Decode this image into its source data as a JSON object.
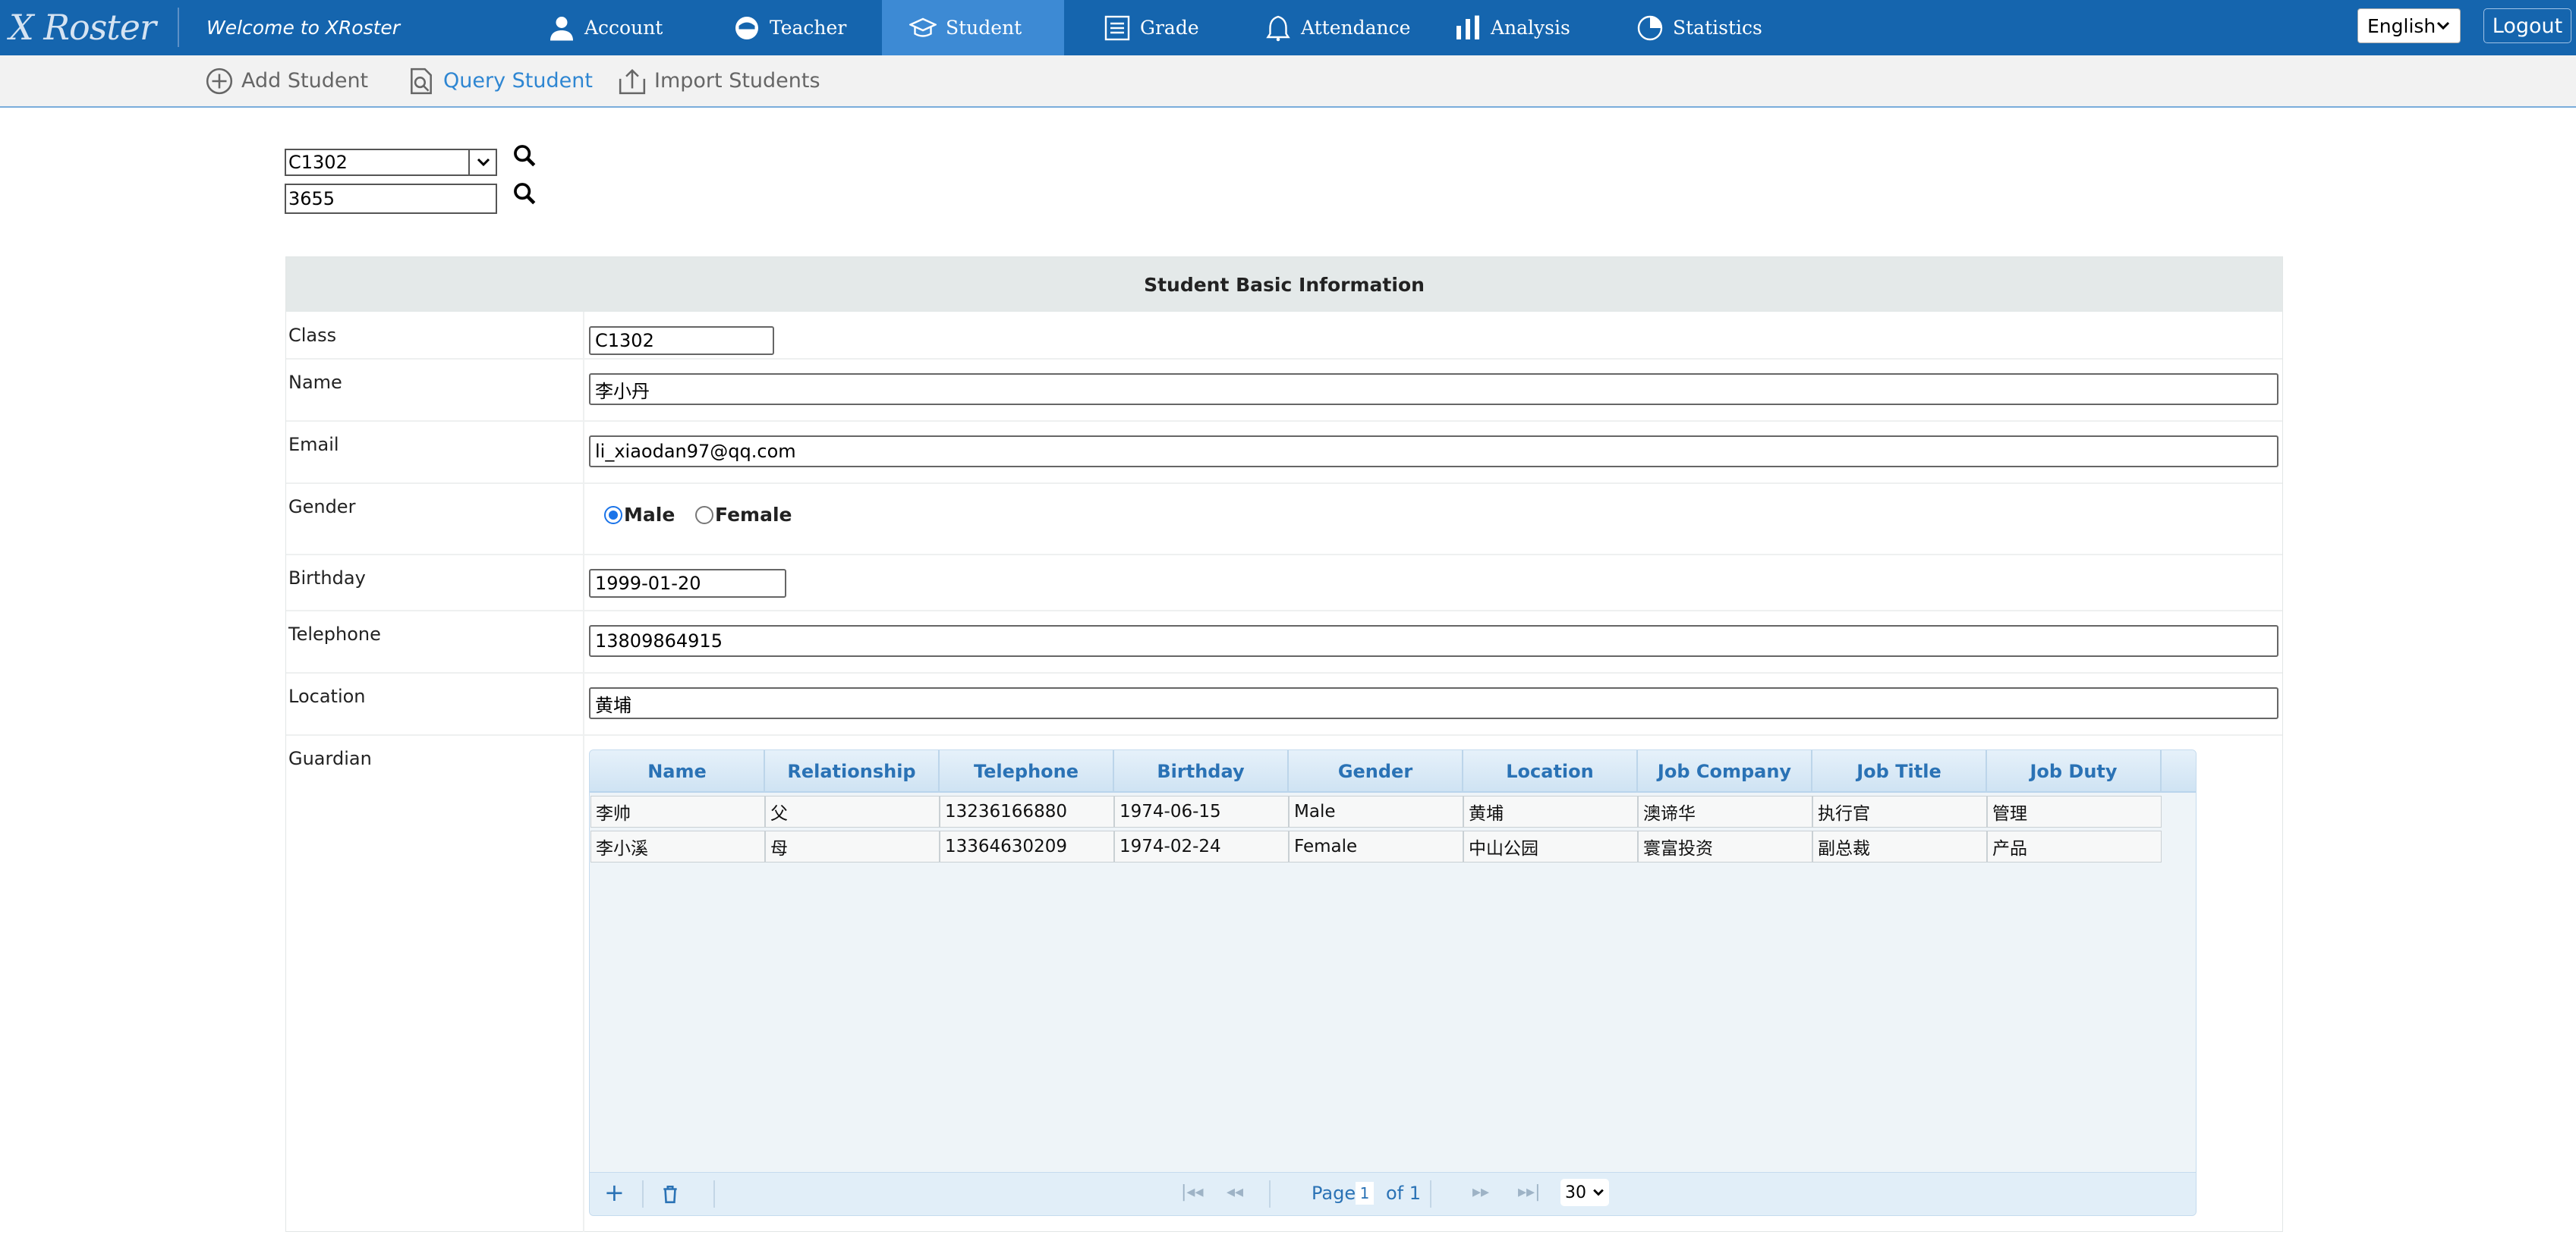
{
  "app": {
    "logo": "X Roster",
    "welcome": "Welcome to XRoster"
  },
  "nav": [
    {
      "label": "Account",
      "icon": "user-icon"
    },
    {
      "label": "Teacher",
      "icon": "teacher-icon"
    },
    {
      "label": "Student",
      "icon": "student-cap-icon",
      "active": true
    },
    {
      "label": "Grade",
      "icon": "grade-list-icon"
    },
    {
      "label": "Attendance",
      "icon": "bell-icon"
    },
    {
      "label": "Analysis",
      "icon": "bar-chart-icon"
    },
    {
      "label": "Statistics",
      "icon": "pie-chart-icon"
    }
  ],
  "header": {
    "language": "English",
    "logout": "Logout"
  },
  "subnav": [
    {
      "label": "Add Student",
      "icon": "add-circle-icon"
    },
    {
      "label": "Query Student",
      "icon": "query-document-icon",
      "active": true
    },
    {
      "label": "Import Students",
      "icon": "upload-icon"
    }
  ],
  "search": {
    "class_value": "C1302",
    "id_value": "3655"
  },
  "form": {
    "title": "Student Basic Information",
    "labels": {
      "class": "Class",
      "name": "Name",
      "email": "Email",
      "gender": "Gender",
      "birthday": "Birthday",
      "telephone": "Telephone",
      "location": "Location",
      "guardian": "Guardian"
    },
    "values": {
      "class": "C1302",
      "name": "李小丹",
      "email": "li_xiaodan97@qq.com",
      "birthday": "1999-01-20",
      "telephone": "13809864915",
      "location": "黄埔"
    },
    "gender": {
      "male": "Male",
      "female": "Female",
      "selected": "Male"
    }
  },
  "guardian_grid": {
    "columns": [
      "Name",
      "Relationship",
      "Telephone",
      "Birthday",
      "Gender",
      "Location",
      "Job Company",
      "Job Title",
      "Job Duty"
    ],
    "rows": [
      [
        "李帅",
        "父",
        "13236166880",
        "1974-06-15",
        "Male",
        "黄埔",
        "澳谛华",
        "执行官",
        "管理"
      ],
      [
        "李小溪",
        "母",
        "13364630209",
        "1974-02-24",
        "Female",
        "中山公园",
        "寰富投资",
        "副总裁",
        "产品"
      ]
    ],
    "pager": {
      "page_label": "Page",
      "page": "1",
      "of_label": "of 1",
      "page_size": "30"
    }
  },
  "colors": {
    "nav_bg": "#1565ae",
    "nav_active": "#3d8ad4",
    "link_active": "#2e86d2",
    "grid_header_text": "#2a72b5"
  }
}
